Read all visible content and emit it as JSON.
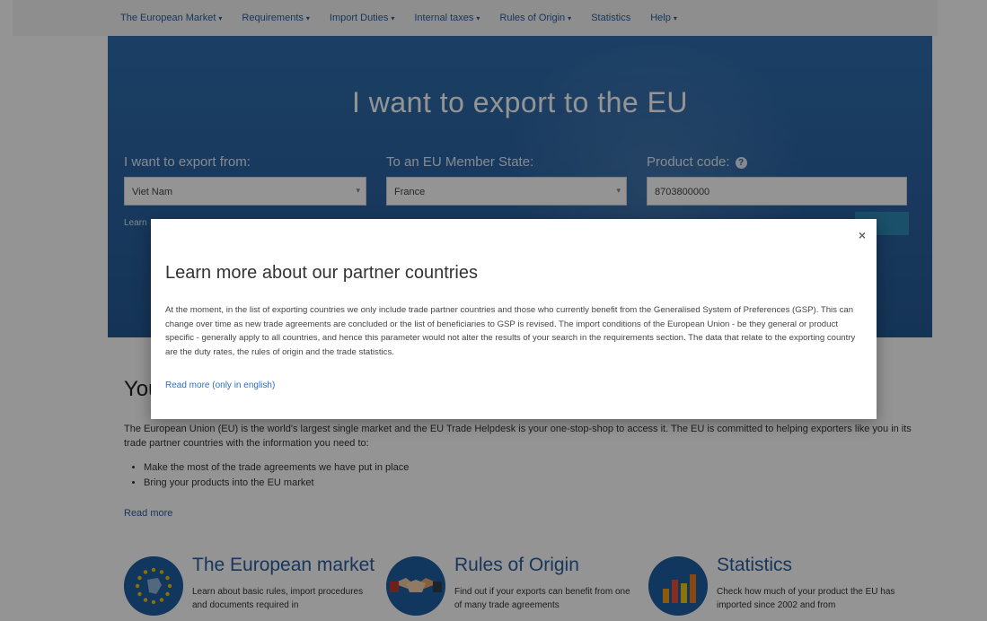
{
  "nav": {
    "items": [
      {
        "label": "The European Market",
        "has_caret": true
      },
      {
        "label": "Requirements",
        "has_caret": true
      },
      {
        "label": "Import Duties",
        "has_caret": true
      },
      {
        "label": "Internal taxes",
        "has_caret": true
      },
      {
        "label": "Rules of Origin",
        "has_caret": true
      },
      {
        "label": "Statistics",
        "has_caret": false
      },
      {
        "label": "Help",
        "has_caret": true
      }
    ]
  },
  "hero": {
    "title": "I want to export to the EU",
    "from_label": "I want to export from:",
    "from_value": "Viet Nam",
    "to_label": "To an EU Member State:",
    "to_value": "France",
    "code_label": "Product code:",
    "code_value": "8703800000",
    "learn_link": "Learn"
  },
  "main": {
    "title": "You",
    "intro": "The European Union (EU) is the world's largest single market and the EU Trade Helpdesk is your one-stop-shop to access it. The EU is committed to helping exporters like you in its trade partner countries with the information you need to:",
    "bullets": [
      "Make the most of the trade agreements we have put in place",
      "Bring your products into the EU market"
    ],
    "read_more": "Read more"
  },
  "cards": [
    {
      "title": "The European market",
      "text": "Learn about basic rules, import procedures and documents required in",
      "icon": "eu-stars-icon"
    },
    {
      "title": "Rules of Origin",
      "text": "Find out if your exports can benefit from one of many trade agreements",
      "icon": "handshake-icon"
    },
    {
      "title": "Statistics",
      "text": "Check how much of your product the EU has imported since 2002 and from",
      "icon": "bar-chart-icon"
    }
  ],
  "modal": {
    "close": "×",
    "title": "Learn more about our partner countries",
    "body": "At the moment, in the list of exporting countries we only include trade partner countries and those who currently benefit from the Generalised System of Preferences (GSP). This can change over time as new trade agreements are concluded or the list of beneficiaries to GSP is revised. The import conditions of the European Union - be they general or product specific - generally apply to all countries, and hence this parameter would not alter the results of your search in the requirements section. The data that relate to the exporting country are the duty rates, the rules of origin and the trade statistics.",
    "link": "Read more (only in english)"
  },
  "colors": {
    "hero_blue": "#2a62a0",
    "link_blue": "#2a5d9f",
    "overlay": "rgba(0,0,0,0.42)"
  }
}
